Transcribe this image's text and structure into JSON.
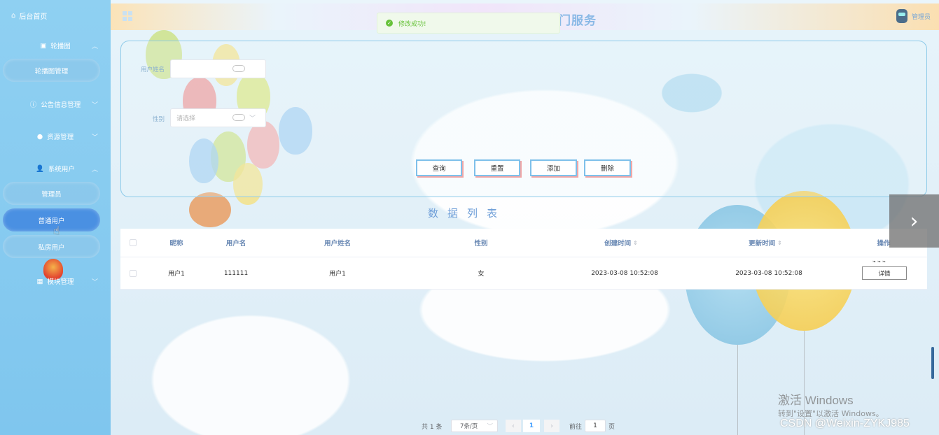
{
  "sidebar": {
    "home_label": "后台首页",
    "groups": [
      {
        "label": "轮播图",
        "expanded": true,
        "children": [
          "轮播图管理"
        ]
      },
      {
        "label": "公告信息管理",
        "expanded": false
      },
      {
        "label": "资源管理",
        "expanded": false
      },
      {
        "label": "系统用户",
        "expanded": true,
        "children": [
          "管理员",
          "普通用户",
          "私房用户"
        ]
      },
      {
        "label": "模块管理",
        "expanded": false
      }
    ],
    "active_item": "普通用户"
  },
  "header": {
    "title_partial": "门服务",
    "user_label": "管理员"
  },
  "toast": {
    "message": "修改成功!",
    "type": "success"
  },
  "search": {
    "username_label": "用户姓名",
    "username_value": "",
    "gender_label": "性别",
    "gender_placeholder": "请选择",
    "buttons": {
      "query": "查询",
      "reset": "重置",
      "add": "添加",
      "delete": "删除"
    }
  },
  "section_title": "数据列表",
  "table": {
    "columns": [
      "昵称",
      "用户名",
      "用户姓名",
      "性别",
      "创建时间",
      "更新时间",
      "操作"
    ],
    "rows": [
      {
        "nickname": "用户1",
        "username": "111111",
        "realname": "用户1",
        "gender": "女",
        "created": "2023-03-08 10:52:08",
        "updated": "2023-03-08 10:52:08",
        "action": "详情"
      }
    ]
  },
  "pagination": {
    "total_text": "共 1 条",
    "page_size": "7条/页",
    "current_page": "1",
    "goto_label": "前往",
    "goto_value": "1",
    "page_suffix": "页"
  },
  "watermark": {
    "line1": "激活 Windows",
    "line2": "转到\"设置\"以激活 Windows。",
    "csdn": "CSDN @Weixin-ZYKJ985"
  },
  "colors": {
    "sidebar_bg": "#8fd0f2",
    "active_item": "#4a90e2",
    "accent_border": "#7ec0ea",
    "success": "#67c23a",
    "header_text": "#6a89b4"
  }
}
